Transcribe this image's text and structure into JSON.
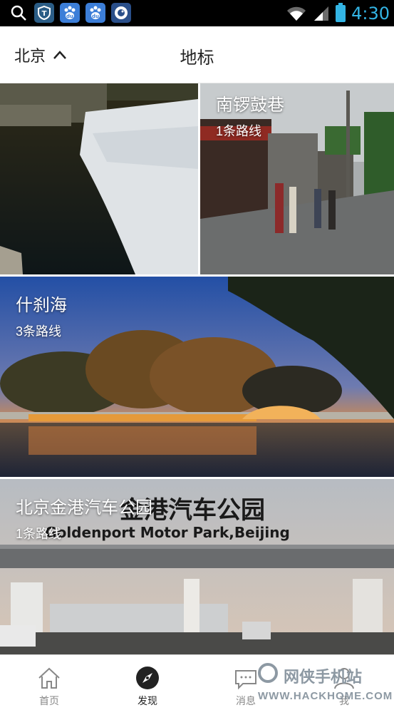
{
  "status_bar": {
    "time": "4:30",
    "icons": [
      "search-icon",
      "shield-icon",
      "baidu-paw-icon",
      "baidu-paw-icon",
      "bird-app-icon",
      "wifi-icon",
      "signal-icon",
      "battery-icon"
    ]
  },
  "header": {
    "city": "北京",
    "title": "地标"
  },
  "landmarks": [
    {
      "name": "",
      "routes": ""
    },
    {
      "name": "南锣鼓巷",
      "routes": "1条路线"
    },
    {
      "name": "什刹海",
      "routes": "3条路线"
    },
    {
      "name": "北京金港汽车公园",
      "routes": "1条路线"
    }
  ],
  "photo_signage": {
    "sign_cn": "金港汽车公园",
    "sign_en": "Goldenport Motor Park,Beijing"
  },
  "tab_bar": {
    "tabs": [
      {
        "label": "首页",
        "icon": "home-icon"
      },
      {
        "label": "发现",
        "icon": "compass-icon"
      },
      {
        "label": "消息",
        "icon": "message-icon"
      },
      {
        "label": "我",
        "icon": "profile-icon"
      }
    ]
  },
  "watermark": {
    "line1": "网侠手机站",
    "line2": "WWW.HACKHOME.COM"
  }
}
